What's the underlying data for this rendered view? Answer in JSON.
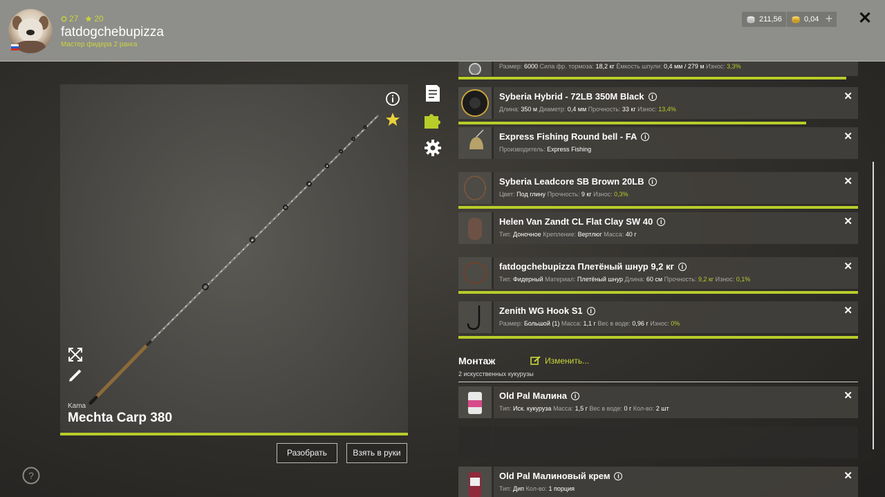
{
  "header": {
    "level": "27",
    "stars": "20",
    "username": "fatdogchebupizza",
    "rank": "Мастер фидера 2 ранга",
    "silver": "211,56",
    "gold": "0,04",
    "plus_label": "+",
    "close_label": "✕"
  },
  "rod": {
    "brand": "Kama",
    "name": "Mechta Carp 380",
    "disassemble_label": "Разобрать",
    "take_label": "Взять в руки"
  },
  "items": [
    {
      "title": "",
      "details": [
        {
          "k": "Размер:",
          "v": "6000"
        },
        {
          "k": "Сила фр. тормоза:",
          "v": "18,2 кг"
        },
        {
          "k": "Ёмкость шпули:",
          "v": "0,4 мм / 279 м"
        },
        {
          "k": "Износ:",
          "v": "3,3%",
          "green": true
        }
      ]
    },
    {
      "title": "Syberia Hybrid - 72LB 350M Black",
      "details": [
        {
          "k": "Длина:",
          "v": "350 м"
        },
        {
          "k": "Диаметр:",
          "v": "0,4 мм"
        },
        {
          "k": "Прочность:",
          "v": "33 кг"
        },
        {
          "k": "Износ:",
          "v": "13,4%",
          "green": true
        }
      ]
    },
    {
      "title": "Express Fishing Round bell - FA",
      "details": [
        {
          "k": "Производитель:",
          "v": "Express Fishing"
        }
      ]
    },
    {
      "title": "Syberia Leadcore SB Brown 20LB",
      "details": [
        {
          "k": "Цвет:",
          "v": "Под глину"
        },
        {
          "k": "Прочность:",
          "v": "9 кг"
        },
        {
          "k": "Износ:",
          "v": "0,3%",
          "green": true
        }
      ]
    },
    {
      "title": "Helen Van Zandt CL Flat Clay SW 40",
      "details": [
        {
          "k": "Тип:",
          "v": "Доночное"
        },
        {
          "k": "Крепление:",
          "v": "Вертлюг"
        },
        {
          "k": "Масса:",
          "v": "40 г"
        }
      ]
    },
    {
      "title": "fatdogchebupizza Плетёный шнур 9,2 кг",
      "details": [
        {
          "k": "Тип:",
          "v": "Фидерный"
        },
        {
          "k": "Материал:",
          "v": "Плетёный шнур"
        },
        {
          "k": "Длина:",
          "v": "60 см"
        },
        {
          "k": "Прочность:",
          "v": "9,2 кг",
          "green": true
        },
        {
          "k": "Износ:",
          "v": "0,1%",
          "green": true
        }
      ]
    },
    {
      "title": "Zenith WG Hook S1",
      "details": [
        {
          "k": "Размер:",
          "v": "Большой (1)"
        },
        {
          "k": "Масса:",
          "v": "1,1 г"
        },
        {
          "k": "Вес в воде:",
          "v": "0,96 г"
        },
        {
          "k": "Износ:",
          "v": "0%",
          "green": true
        }
      ]
    }
  ],
  "wear_bars": {
    "reel": 0.97,
    "line": 0.87
  },
  "montage": {
    "title": "Монтаж",
    "change_label": "Изменить...",
    "subtitle": "2 искусственных кукурузы"
  },
  "baits": [
    {
      "title": "Old Pal Малина",
      "details": [
        {
          "k": "Тип:",
          "v": "Иск. кукуруза"
        },
        {
          "k": "Масса:",
          "v": "1,5 г"
        },
        {
          "k": "Вес в воде:",
          "v": "0 г"
        },
        {
          "k": "Кол-во:",
          "v": "2 шт"
        }
      ]
    },
    {
      "title": "Old Pal Малиновый крем",
      "details": [
        {
          "k": "Тип:",
          "v": "Дип"
        },
        {
          "k": "Кол-во:",
          "v": "1 порция"
        }
      ]
    }
  ],
  "colors": {
    "accent": "#b8cc2a",
    "header_bg": "#8e8e8b",
    "panel_bg": "#42403c"
  }
}
